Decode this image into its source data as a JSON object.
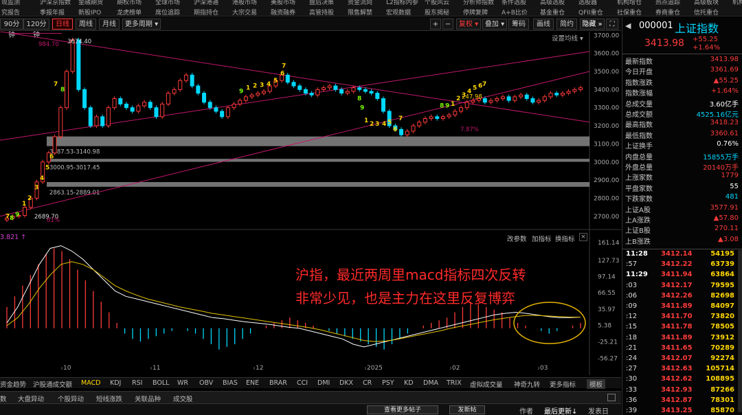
{
  "top_menu": {
    "row1": [
      "现监测",
      "沪深京指数",
      "金融期货",
      "期权市场",
      "全球市场",
      "沪深港通",
      "港股市场",
      "美股市场",
      "盘后决策",
      "资金流向",
      "L2指标内参",
      "个股风云",
      "分析师指数",
      "条件选股",
      "高级选股",
      "选股器",
      "机构增仓",
      "热点追踪",
      "高级板块",
      "机构持"
    ],
    "row2": [
      "究报告",
      "季报年报",
      "新股IPO",
      "龙虎榜单",
      "席位追踪",
      "期指持仓",
      "大宗交易",
      "融资融券",
      "高管持股",
      "限售解禁",
      "宏观数据",
      "股东揭秘",
      "停牌复牌",
      "A+B比价",
      "基金重仓",
      "QFII重仓",
      "社保重仓",
      "券商重仓",
      "信托重仓"
    ]
  },
  "toolbar": {
    "periods": [
      "90分钟",
      "120分钟",
      "日线",
      "周线",
      "月线",
      "更多周期 ▾"
    ],
    "active_period": "日线",
    "right_buttons": [
      "+",
      "−",
      "复权 ▾",
      "叠加 ▾",
      "筹码",
      "画线",
      "简约",
      "隐藏 »",
      ""
    ],
    "settings": "设置均线 ▾"
  },
  "chart_data": [
    {
      "type": "candlestick",
      "title": "上证指数 日线",
      "ylim": [
        2650,
        3720
      ],
      "y_ticks": [
        2700,
        2800,
        2900,
        3000,
        3100,
        3200,
        3300,
        3400,
        3500,
        3600,
        3700
      ],
      "x_month_labels": [
        "10",
        "11",
        "12",
        "2025",
        "02",
        "03"
      ],
      "ohlc_close_path": [
        2690,
        2700,
        2705,
        2750,
        2800,
        2890,
        3000,
        3050,
        3140,
        3300,
        3500,
        3674,
        3400,
        3300,
        3200,
        3250,
        3200,
        3300,
        3350,
        3320,
        3300,
        3280,
        3310,
        3330,
        3300,
        3250,
        3320,
        3380,
        3400,
        3450,
        3480,
        3420,
        3380,
        3330,
        3300,
        3280,
        3250,
        3300,
        3320,
        3340,
        3360,
        3370,
        3380,
        3390,
        3420,
        3450,
        3480,
        3440,
        3420,
        3400,
        3380,
        3370,
        3400,
        3410,
        3420,
        3400,
        3380,
        3390,
        3410,
        3400,
        3390,
        3380,
        3350,
        3280,
        3200,
        3180,
        3150,
        3170,
        3200,
        3220,
        3240,
        3250,
        3240,
        3250,
        3260,
        3280,
        3300,
        3330,
        3340,
        3350,
        3330,
        3340,
        3350,
        3360,
        3340,
        3360,
        3370,
        3350,
        3330,
        3340,
        3360,
        3380,
        3370,
        3380,
        3390,
        3400,
        3410
      ],
      "annotations": {
        "high_label": "3674.40",
        "high_ref": "984.70",
        "low_label": "2689.70",
        "low_pct": "61%",
        "pct_label": "7.87%",
        "ref_label": "247.98"
      },
      "zones": [
        "3087.53-3140.98",
        "3000.95-3017.45",
        "2863.15-2889.01"
      ],
      "td_numbers": [
        "7",
        "8",
        "9",
        "1",
        "2",
        "3",
        "4",
        "5",
        "6",
        "7",
        "8",
        "9",
        "1",
        "2",
        "3",
        "4",
        "5",
        "6",
        "7",
        "8",
        "9",
        "1",
        "2",
        "3",
        "4",
        "5",
        "6",
        "7",
        "8",
        "9",
        "1",
        "2",
        "3",
        "4",
        "5",
        "6",
        "7",
        "8",
        "9"
      ]
    },
    {
      "type": "bar",
      "title": "MACD",
      "ylim": [
        -70,
        170
      ],
      "y_ticks": [
        161.14,
        127.73,
        97.14,
        66.55,
        35.97,
        5.38,
        -25.21,
        -56.27
      ],
      "header_value": "3.821 ↑",
      "buttons": [
        "改参数",
        "加指标",
        "换指标"
      ],
      "histogram": [
        40,
        60,
        80,
        100,
        120,
        140,
        150,
        145,
        130,
        110,
        90,
        70,
        50,
        30,
        10,
        -10,
        -20,
        -25,
        -20,
        -15,
        -10,
        -5,
        0,
        -5,
        -10,
        -20,
        -30,
        -40,
        -35,
        -30,
        -20,
        -10,
        0,
        5,
        10,
        15,
        20,
        15,
        10,
        5,
        0,
        -5,
        -10,
        -15,
        -20,
        -25,
        -30,
        -35,
        -40,
        -30,
        -20,
        -10,
        0,
        5,
        10,
        15,
        20,
        30,
        40,
        50,
        45,
        40,
        35,
        30,
        20,
        10,
        5,
        0,
        -5,
        -10,
        -5,
        0,
        5,
        10
      ],
      "dif": [
        10,
        40,
        80,
        120,
        150,
        155,
        145,
        130,
        110,
        90,
        70,
        60,
        55,
        50,
        45,
        40,
        35,
        30,
        25,
        20,
        18,
        15,
        12,
        10,
        8,
        5,
        2,
        0,
        -5,
        -10,
        -15,
        -20,
        -30,
        -35,
        -30,
        -25,
        -20,
        -15,
        -10,
        -5,
        0,
        5,
        10,
        15,
        20,
        25,
        28,
        30,
        28,
        25,
        22,
        20,
        20,
        21
      ],
      "dea": [
        5,
        20,
        45,
        75,
        100,
        120,
        125,
        120,
        110,
        95,
        80,
        70,
        62,
        55,
        50,
        45,
        40,
        36,
        32,
        28,
        25,
        22,
        19,
        16,
        13,
        10,
        7,
        4,
        1,
        -3,
        -8,
        -13,
        -18,
        -23,
        -25,
        -24,
        -21,
        -17,
        -13,
        -9,
        -5,
        0,
        4,
        8,
        12,
        16,
        19,
        22,
        24,
        24,
        23,
        22,
        21,
        21
      ]
    }
  ],
  "annotation_text": [
    "沪指，最近两周里macd指标四次反转",
    "非常少见，也是主力在这里反复博弈"
  ],
  "indicator_tabs": [
    "资金趋势",
    "沪股通成交额",
    "MACD",
    "KDJ",
    "RSI",
    "BOLL",
    "WR",
    "OBV",
    "BIAS",
    "ENE",
    "BRAR",
    "CCI",
    "DMI",
    "DKX",
    "CR",
    "PSY",
    "KD",
    "DMA",
    "TRIX",
    "虚拟成交量",
    "神奇九转",
    "更多指标",
    "模板"
  ],
  "active_indicator": "MACD",
  "bottom_tabs": [
    "数",
    "大盘异动",
    "个股异动",
    "短线涨跌",
    "关联品种",
    "成交股"
  ],
  "footer": {
    "buttons": [
      "查看更多帖子",
      "发新帖"
    ],
    "right": [
      "作者",
      "最后更新↓",
      "发表日"
    ]
  },
  "quote_panel": {
    "code": "000001",
    "name": "上证指数",
    "price": "3413.98",
    "change": "+55.25",
    "change_pct": "+1.64%",
    "rows": [
      {
        "k": "最新指数",
        "v": "3413.98",
        "c": "red"
      },
      {
        "k": "今日开盘",
        "v": "3361.69",
        "c": "red"
      },
      {
        "k": "指数涨跌",
        "v": "▲55.25",
        "c": "red"
      },
      {
        "k": "指数涨幅",
        "v": "+1.64%",
        "c": "red"
      },
      {
        "k": "总成交量",
        "v": "3.60亿手",
        "c": "white"
      },
      {
        "k": "总成交额",
        "v": "4525.16亿元",
        "c": "green"
      },
      {
        "k": "最高指数",
        "v": "3418.23",
        "c": "red"
      },
      {
        "k": "最低指数",
        "v": "3360.61",
        "c": "red"
      },
      {
        "k": "上证换手",
        "v": "0.76%",
        "c": "white"
      },
      {
        "k": "内盘总量",
        "v": "15855万手",
        "c": "green"
      },
      {
        "k": "外盘总量",
        "v": "20140万手",
        "c": "red"
      },
      {
        "k": "上涨家数",
        "v": "1779",
        "c": "red"
      },
      {
        "k": "平盘家数",
        "v": "55",
        "c": "white"
      },
      {
        "k": "下跌家数",
        "v": "481",
        "c": "green"
      },
      {
        "k": "上证A股",
        "v": "3577.91",
        "c": "red"
      },
      {
        "k": "上A涨跌",
        "v": "▲57.80",
        "c": "red"
      },
      {
        "k": "上证B股",
        "v": "270.11",
        "c": "red"
      },
      {
        "k": "上B涨跌",
        "v": "▲3.08",
        "c": "red"
      }
    ],
    "ticks": [
      {
        "t": "11:28",
        "p": "3412.14",
        "q": "54195",
        "bt": true
      },
      {
        "t": ":57",
        "p": "3412.22",
        "q": "63739"
      },
      {
        "t": "11:29",
        "p": "3411.94",
        "q": "63864",
        "bt": true
      },
      {
        "t": ":03",
        "p": "3412.17",
        "q": "79595"
      },
      {
        "t": ":06",
        "p": "3412.26",
        "q": "82698"
      },
      {
        "t": ":09",
        "p": "3411.89",
        "q": "84097"
      },
      {
        "t": ":12",
        "p": "3411.70",
        "q": "73820"
      },
      {
        "t": ":15",
        "p": "3411.78",
        "q": "78505"
      },
      {
        "t": ":18",
        "p": "3411.89",
        "q": "73912"
      },
      {
        "t": ":21",
        "p": "3411.65",
        "q": "70289"
      },
      {
        "t": ":24",
        "p": "3412.07",
        "q": "92274"
      },
      {
        "t": ":27",
        "p": "3412.63",
        "q": "105714"
      },
      {
        "t": ":30",
        "p": "3412.62",
        "q": "108895"
      },
      {
        "t": ":33",
        "p": "3412.93",
        "q": "87266"
      },
      {
        "t": ":36",
        "p": "3412.87",
        "q": "78301"
      },
      {
        "t": ":39",
        "p": "3413.25",
        "q": "85870"
      }
    ]
  },
  "colors": {
    "up": "#ff3b3b",
    "down": "#00d8ff",
    "dif": "#ffffff",
    "dea": "#e6c200",
    "channel": "#c0186b",
    "annotation": "#ff2a2a"
  }
}
